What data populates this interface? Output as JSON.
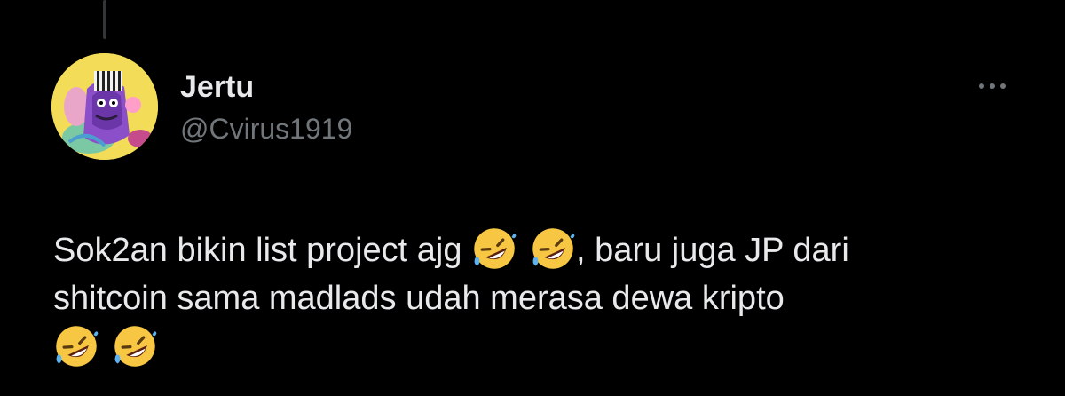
{
  "tweet": {
    "author": {
      "display_name": "Jertu",
      "handle": "@Cvirus1919"
    },
    "text": {
      "line1_part1": "Sok2an bikin list project ajg",
      "line1_part2": ", baru juga JP dari",
      "line2": "shitcoin sama madlads udah merasa dewa kripto"
    },
    "emoji": "rolling-on-the-floor-laughing",
    "more_icon": "more-horizontal-icon"
  },
  "colors": {
    "background": "#000000",
    "text_primary": "#e7e9ea",
    "text_secondary": "#71767b",
    "thread_line": "#333639",
    "avatar_background": "#f3dc58"
  }
}
